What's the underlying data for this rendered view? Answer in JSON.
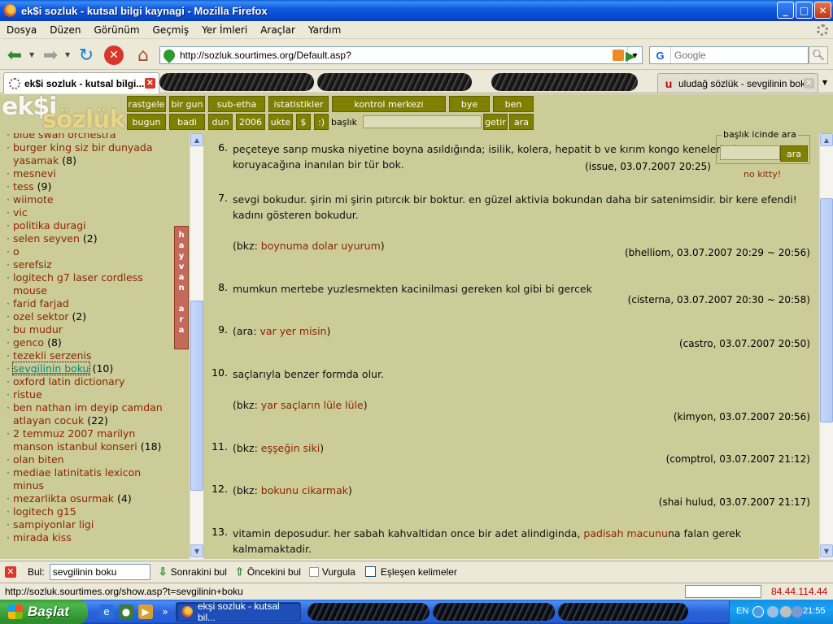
{
  "window": {
    "title": "ek$i sozluk - kutsal bilgi kaynagi - Mozilla Firefox",
    "min": "_",
    "max": "□",
    "close": "✕"
  },
  "menu": [
    "Dosya",
    "Düzen",
    "Görünüm",
    "Geçmiş",
    "Yer İmleri",
    "Araçlar",
    "Yardım"
  ],
  "nav": {
    "url": "http://sozluk.sourtimes.org/Default.asp?",
    "search_engine": "G",
    "search_placeholder": "Google"
  },
  "tabs": {
    "active": "ek$i sozluk - kutsal bilgi...",
    "last": "uludağ sözlük - sevgilinin boku",
    "ulu_icon": "u"
  },
  "site": {
    "logo_top": "ek$i",
    "logo_bottom": "sözlük",
    "row1": [
      "rastgele",
      "bir gun",
      "sub-etha",
      "istatistikler",
      "kontrol merkezi",
      "bye",
      "ben"
    ],
    "row2": [
      "bugun",
      "badi",
      "dun",
      "2006",
      "ukte",
      "$",
      ":)"
    ],
    "baslik_label": "başlık",
    "getir": "getir",
    "ara": "ara",
    "side_search_legend": "başlık icinde ara",
    "side_search_btn": "ara",
    "no_kitty": "no kitty!",
    "hayvan_ara": "hayvan ara"
  },
  "left_topics": [
    {
      "title": "blue swan orchestra",
      "count": ""
    },
    {
      "title": "burger king siz bir dunyada yasamak",
      "count": "(8)"
    },
    {
      "title": "mesnevi",
      "count": ""
    },
    {
      "title": "tess",
      "count": "(9)"
    },
    {
      "title": "wiimote",
      "count": ""
    },
    {
      "title": "vic",
      "count": ""
    },
    {
      "title": "politika duragi",
      "count": ""
    },
    {
      "title": "selen seyven",
      "count": "(2)"
    },
    {
      "title": "o",
      "count": ""
    },
    {
      "title": "serefsiz",
      "count": ""
    },
    {
      "title": "logitech g7 laser cordless mouse",
      "count": ""
    },
    {
      "title": "farid farjad",
      "count": ""
    },
    {
      "title": "ozel sektor",
      "count": "(2)"
    },
    {
      "title": "bu mudur",
      "count": ""
    },
    {
      "title": "genco",
      "count": "(8)"
    },
    {
      "title": "tezekli serzenis",
      "count": ""
    },
    {
      "title": "sevgilinin boku",
      "count": "(10)"
    },
    {
      "title": "oxford latin dictionary",
      "count": ""
    },
    {
      "title": "ristue",
      "count": ""
    },
    {
      "title": "ben nathan im deyip camdan atlayan cocuk",
      "count": "(22)"
    },
    {
      "title": "2 temmuz 2007 marilyn manson istanbul konseri",
      "count": "(18)"
    },
    {
      "title": "olan biten",
      "count": ""
    },
    {
      "title": "mediae latinitatis lexicon minus",
      "count": ""
    },
    {
      "title": "mezarlikta osurmak",
      "count": "(4)"
    },
    {
      "title": "logitech g15",
      "count": ""
    },
    {
      "title": "sampiyonlar ligi",
      "count": ""
    },
    {
      "title": "mirada kiss",
      "count": ""
    }
  ],
  "entries": [
    {
      "num": "6.",
      "text": "peçeteye sarıp muska niyetine boyna asıldığında; isilik, kolera, hepatit b ve kırım kongo kenelerinden koruyacağına inanılan bir tür bok.",
      "author": "issue",
      "date": ", 03.07.2007 20:25)"
    },
    {
      "num": "7.",
      "text": "sevgi bokudur. şirin mi şirin pıtırcık bir boktur. en güzel aktivia bokundan daha bir satenimsidir. bir kere efendi! kadını gösteren bokudur.",
      "ref_prefix": "(bkz: ",
      "ref": "boynuma dolar uyurum",
      "ref_suffix": ")",
      "author": "bhelliom",
      "date": ", 03.07.2007 20:29 ~ 20:56)"
    },
    {
      "num": "8.",
      "text": "mumkun mertebe yuzlesmekten kacinilmasi gereken kol gibi bi gercek",
      "author": "cisterna",
      "date": ", 03.07.2007 20:30 ~ 20:58)"
    },
    {
      "num": "9.",
      "prefix": "(ara: ",
      "link": "var yer misin",
      "suffix": ")",
      "author": "castro",
      "date": ", 03.07.2007 20:50)"
    },
    {
      "num": "10.",
      "text": "saçlarıyla benzer formda olur.",
      "ref_prefix": "(bkz: ",
      "ref": "yar saçların lüle lüle",
      "ref_suffix": ")",
      "author": "kimyon",
      "date": ", 03.07.2007 20:56)"
    },
    {
      "num": "11.",
      "prefix": "(bkz: ",
      "link": "eşşeğin siki",
      "suffix": ")",
      "author": "comptrol",
      "date": ", 03.07.2007 21:12)"
    },
    {
      "num": "12.",
      "prefix": "(bkz: ",
      "link": "bokunu cikarmak",
      "suffix": ")",
      "author": "shai hulud",
      "date": ", 03.07.2007 21:17)"
    },
    {
      "num": "13.",
      "prefix": "vitamin deposudur. her sabah kahvaltidan once bir adet alindiginda, ",
      "link": "padisah macunu",
      "suffix": "na falan gerek kalmamaktadir."
    }
  ],
  "findbar": {
    "close": "✕",
    "label": "Bul:",
    "value": "sevgilinin boku",
    "next": "Sonrakini bul",
    "prev": "Öncekini bul",
    "highlight": "Vurgula",
    "match_case": "Eşleşen kelimeler"
  },
  "status": {
    "text": "http://sozluk.sourtimes.org/show.asp?t=sevgilinin+boku",
    "ip": "84.44.114.44"
  },
  "taskbar": {
    "start": "Başlat",
    "item": "ekşi sozluk - kutsal bil...",
    "more": "»",
    "lang": "EN",
    "clock": "21:55"
  },
  "colors": {
    "site_bg": "#CCCC99",
    "button_bg": "#808000",
    "link": "#8B2500"
  }
}
